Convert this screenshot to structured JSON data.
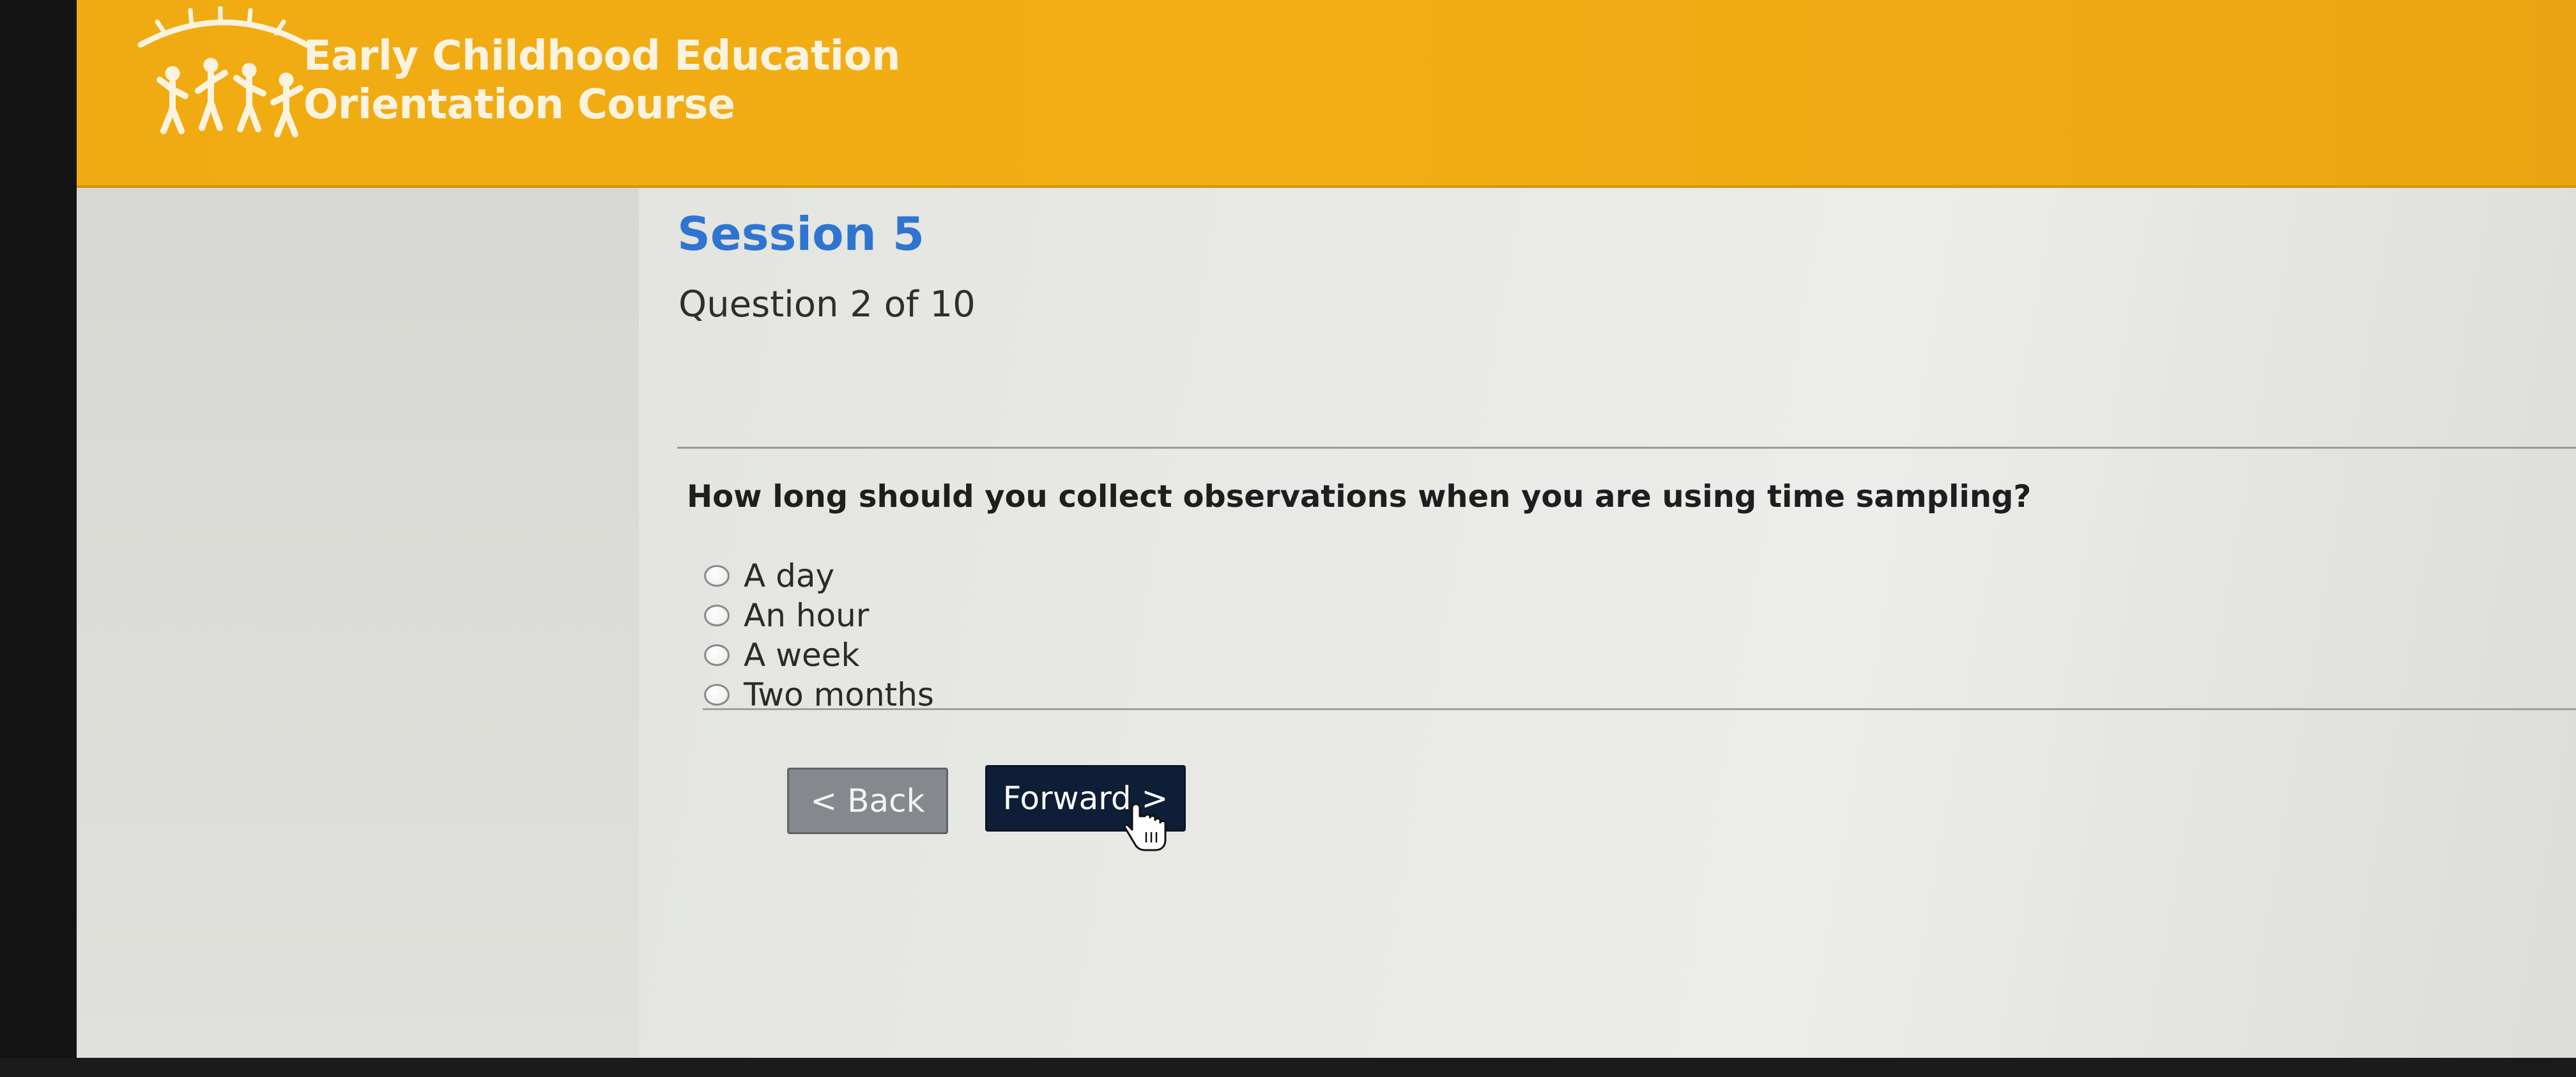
{
  "header": {
    "logo_icon": "children-silhouettes-logo-icon",
    "title_line1": "Early Childhood Education",
    "title_line2": "Orientation Course"
  },
  "main": {
    "session_title": "Session 5",
    "question_count": "Question 2 of 10",
    "question_text": "How long should you collect observations when you are using time sampling?",
    "options": [
      {
        "label": "A day",
        "selected": false
      },
      {
        "label": "An hour",
        "selected": false
      },
      {
        "label": "A week",
        "selected": false
      },
      {
        "label": "Two months",
        "selected": false
      }
    ],
    "back_label": "< Back",
    "forward_label": "Forward >",
    "cursor_icon": "hand-pointer-icon"
  },
  "colors": {
    "header_bg": "#f0ab12",
    "session_title": "#2f75d0",
    "forward_button_bg": "#0d1e36",
    "back_button_bg": "#85898e"
  }
}
